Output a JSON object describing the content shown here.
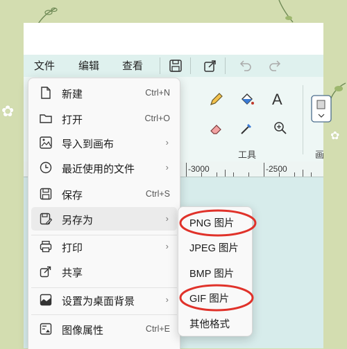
{
  "menubar": {
    "file": "文件",
    "edit": "编辑",
    "view": "查看"
  },
  "toolbar_icons": [
    "save-icon",
    "share-icon",
    "undo-icon",
    "redo-icon"
  ],
  "ribbon": {
    "tools_group_label": "工具",
    "image_group_label": "画",
    "text_tool_glyph": "A"
  },
  "ruler": {
    "labels": [
      "-3000",
      "-2500"
    ]
  },
  "file_menu": {
    "items": [
      {
        "label": "新建",
        "shortcut": "Ctrl+N",
        "icon": "new-file-icon"
      },
      {
        "label": "打开",
        "shortcut": "Ctrl+O",
        "icon": "folder-icon"
      },
      {
        "label": "导入到画布",
        "shortcut": "",
        "icon": "import-image-icon"
      },
      {
        "label": "最近使用的文件",
        "shortcut": "",
        "icon": "clock-icon"
      },
      {
        "label": "保存",
        "shortcut": "Ctrl+S",
        "icon": "save-icon"
      },
      {
        "label": "另存为",
        "shortcut": "",
        "icon": "save-as-icon"
      },
      {
        "label": "打印",
        "shortcut": "",
        "icon": "printer-icon"
      },
      {
        "label": "共享",
        "shortcut": "",
        "icon": "share-icon"
      },
      {
        "label": "设置为桌面背景",
        "shortcut": "",
        "icon": "desktop-background-icon"
      },
      {
        "label": "图像属性",
        "shortcut": "Ctrl+E",
        "icon": "image-properties-icon"
      }
    ]
  },
  "save_as_submenu": {
    "items": [
      "PNG 图片",
      "JPEG 图片",
      "BMP 图片",
      "GIF 图片",
      "其他格式"
    ]
  },
  "colors": {
    "highlight_circle": "#e0322a",
    "menubar_bg": "#dff1ee",
    "background": "#d3ddb0"
  }
}
